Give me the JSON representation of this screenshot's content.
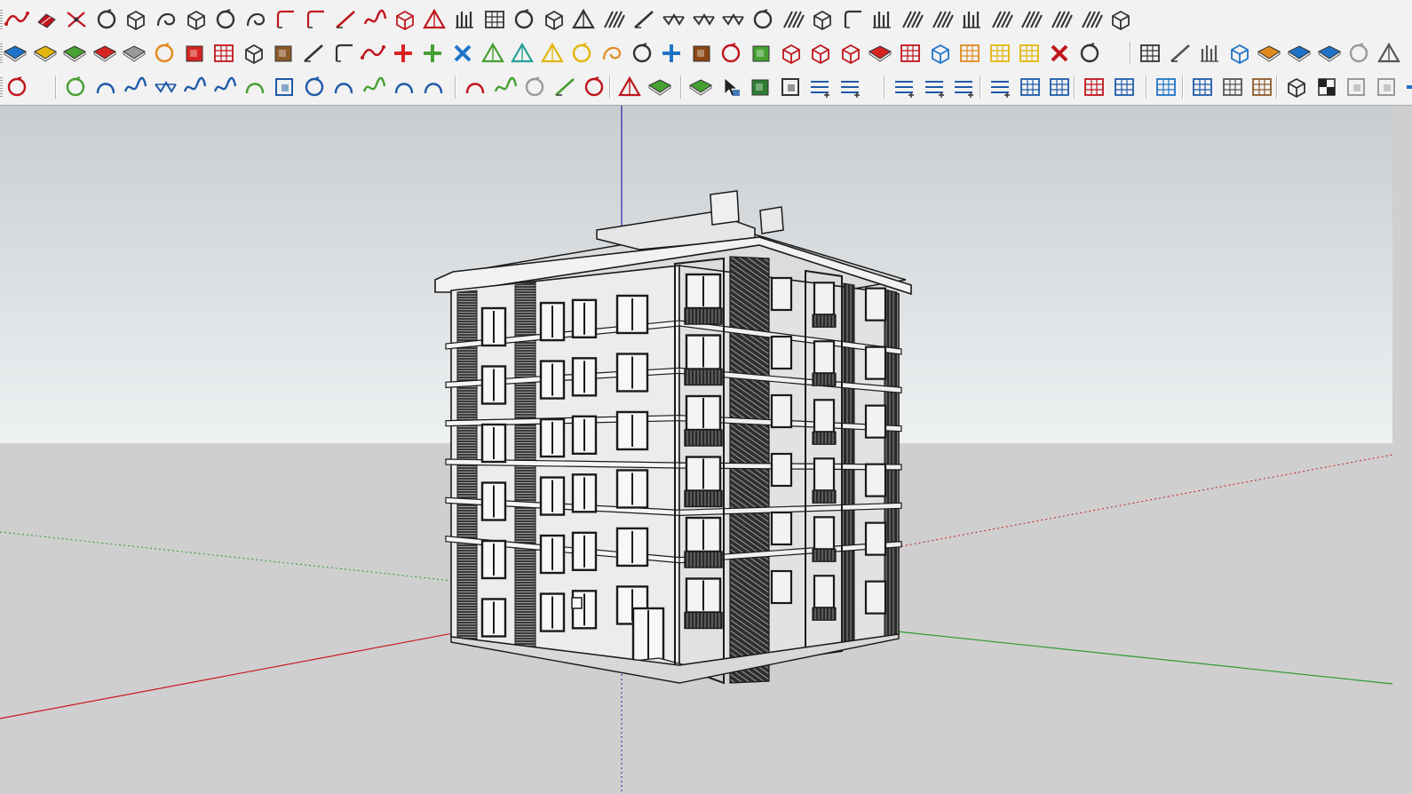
{
  "toolbars": {
    "rows": [
      [
        {
          "name": "bezier-curve-icon",
          "kind": "curve",
          "c": "#c0151d"
        },
        {
          "name": "erase-edges-icon",
          "kind": "eraser",
          "c": "#c0151d"
        },
        {
          "name": "weld-lines-icon",
          "kind": "cross",
          "c": "#c0151d"
        },
        {
          "name": "loft-icon",
          "kind": "loop",
          "c": "#333333"
        },
        {
          "name": "curviloft-icon",
          "kind": "box",
          "c": "#333333"
        },
        {
          "name": "skin-icon",
          "kind": "swirl",
          "c": "#333333"
        },
        {
          "name": "shell-icon",
          "kind": "box",
          "c": "#333333"
        },
        {
          "name": "roundcorner-icon",
          "kind": "loop",
          "c": "#333333"
        },
        {
          "name": "extrude-along-path-icon",
          "kind": "swirl",
          "c": "#333333"
        },
        {
          "name": "fillet-icon",
          "kind": "corner",
          "c": "#c0151d"
        },
        {
          "name": "chamfer-icon",
          "kind": "corner",
          "c": "#c0151d"
        },
        {
          "name": "extend-icon",
          "kind": "slash",
          "c": "#c0151d"
        },
        {
          "name": "trim-icon",
          "kind": "wave",
          "c": "#c0151d"
        },
        {
          "name": "mesh-icon",
          "kind": "box",
          "c": "#c0151d"
        },
        {
          "name": "section-icon",
          "kind": "tri",
          "c": "#c0151d"
        },
        {
          "name": "columns-icon",
          "kind": "bars",
          "c": "#333333"
        },
        {
          "name": "stairs-icon",
          "kind": "grid",
          "c": "#333333"
        },
        {
          "name": "hand-icon",
          "kind": "loop",
          "c": "#333333"
        },
        {
          "name": "window-icon",
          "kind": "box",
          "c": "#333333"
        },
        {
          "name": "door-icon",
          "kind": "tri",
          "c": "#333333"
        },
        {
          "name": "slab-icon",
          "kind": "hatch",
          "c": "#333333"
        },
        {
          "name": "ramp-icon",
          "kind": "slash",
          "c": "#333333"
        },
        {
          "name": "truss-icon",
          "kind": "zig",
          "c": "#333333"
        },
        {
          "name": "beam-icon",
          "kind": "zig",
          "c": "#333333"
        },
        {
          "name": "rafter-icon",
          "kind": "zig",
          "c": "#333333"
        },
        {
          "name": "dome-icon",
          "kind": "loop",
          "c": "#333333"
        },
        {
          "name": "roof-icon",
          "kind": "hatch",
          "c": "#333333"
        },
        {
          "name": "wall-icon",
          "kind": "box",
          "c": "#333333"
        },
        {
          "name": "stair-icon",
          "kind": "corner",
          "c": "#333333"
        },
        {
          "name": "fence-icon",
          "kind": "bars",
          "c": "#333333"
        },
        {
          "name": "railing-icon",
          "kind": "hatch",
          "c": "#333333"
        },
        {
          "name": "slat-icon",
          "kind": "hatch",
          "c": "#333333"
        },
        {
          "name": "grille-icon",
          "kind": "bars",
          "c": "#333333"
        },
        {
          "name": "roof-truss-icon",
          "kind": "hatch",
          "c": "#333333"
        },
        {
          "name": "shingles-icon",
          "kind": "hatch",
          "c": "#333333"
        },
        {
          "name": "cladding-icon",
          "kind": "hatch",
          "c": "#333333"
        },
        {
          "name": "frame-icon",
          "kind": "hatch",
          "c": "#333333"
        },
        {
          "name": "house-icon",
          "kind": "box",
          "c": "#333333"
        }
      ],
      [
        {
          "name": "plane-blue-icon",
          "kind": "diamond",
          "c": "#1e73c8"
        },
        {
          "name": "plane-yellow-icon",
          "kind": "diamond",
          "c": "#e3b50e"
        },
        {
          "name": "plane-green-icon",
          "kind": "diamond",
          "c": "#46a032"
        },
        {
          "name": "plane-red-icon",
          "kind": "diamond",
          "c": "#d62323"
        },
        {
          "name": "plane-outline-icon",
          "kind": "diamond",
          "c": "#9a9a9a"
        },
        {
          "name": "rotate-orange-icon",
          "kind": "loop",
          "c": "#e08a1e"
        },
        {
          "name": "push-red-icon",
          "kind": "square",
          "c": "#d62323"
        },
        {
          "name": "grid-red-icon",
          "kind": "grid",
          "c": "#c0151d"
        },
        {
          "name": "flag-icon",
          "kind": "box",
          "c": "#333333"
        },
        {
          "name": "crate-icon",
          "kind": "square",
          "c": "#8b5a2b"
        },
        {
          "name": "link-icon",
          "kind": "slash",
          "c": "#333333"
        },
        {
          "name": "offset-icon",
          "kind": "corner",
          "c": "#333333"
        },
        {
          "name": "polyline-icon",
          "kind": "curve",
          "c": "#c0151d"
        },
        {
          "name": "cross-red-icon",
          "kind": "plus",
          "c": "#d62323"
        },
        {
          "name": "cross-green-icon",
          "kind": "plus",
          "c": "#46a032"
        },
        {
          "name": "cross-blue-icon",
          "kind": "xcross",
          "c": "#1e73c8"
        },
        {
          "name": "cone-green-icon",
          "kind": "tri",
          "c": "#46a032"
        },
        {
          "name": "cone-teal-icon",
          "kind": "tri",
          "c": "#2aa198"
        },
        {
          "name": "cone-yellow-icon",
          "kind": "tri",
          "c": "#e3b50e"
        },
        {
          "name": "helix-icon",
          "kind": "loop",
          "c": "#e3b50e"
        },
        {
          "name": "spiral-icon",
          "kind": "swirl",
          "c": "#e08a1e"
        },
        {
          "name": "rotate-icon",
          "kind": "loop",
          "c": "#333333"
        },
        {
          "name": "move-icon",
          "kind": "plus",
          "c": "#1e73c8"
        },
        {
          "name": "cylinder-icon",
          "kind": "square",
          "c": "#8b4513"
        },
        {
          "name": "undo-icon",
          "kind": "loop",
          "c": "#c0151d"
        },
        {
          "name": "puzzle-icon",
          "kind": "square",
          "c": "#46a032"
        },
        {
          "name": "component-a-icon",
          "kind": "box",
          "c": "#c0151d"
        },
        {
          "name": "component-b-icon",
          "kind": "box",
          "c": "#c0151d"
        },
        {
          "name": "component-c-icon",
          "kind": "box",
          "c": "#c0151d"
        },
        {
          "name": "gem-icon",
          "kind": "diamond",
          "c": "#d62323"
        },
        {
          "name": "array-icon",
          "kind": "grid",
          "c": "#c0151d"
        },
        {
          "name": "panel-icon",
          "kind": "box",
          "c": "#1e73c8"
        },
        {
          "name": "tile-a-icon",
          "kind": "grid",
          "c": "#e08a1e"
        },
        {
          "name": "tile-b-icon",
          "kind": "grid",
          "c": "#e3b50e"
        },
        {
          "name": "tile-c-icon",
          "kind": "grid",
          "c": "#e3b50e"
        },
        {
          "name": "scatter-icon",
          "kind": "xcross",
          "c": "#c0151d"
        },
        {
          "name": "circle-points-icon",
          "kind": "loop",
          "c": "#333333"
        },
        {
          "name": "dimension-grid-icon",
          "kind": "grid",
          "c": "#333333"
        },
        {
          "name": "pencil-icon",
          "kind": "slash",
          "c": "#555555"
        },
        {
          "name": "align-icon",
          "kind": "bars",
          "c": "#555555"
        },
        {
          "name": "sandbox-icon",
          "kind": "box",
          "c": "#1e73c8"
        },
        {
          "name": "bucket-orange-icon",
          "kind": "diamond",
          "c": "#e08a1e"
        },
        {
          "name": "bucket-blue-icon",
          "kind": "diamond",
          "c": "#1e73c8"
        },
        {
          "name": "push-blue-icon",
          "kind": "diamond",
          "c": "#1e73c8"
        },
        {
          "name": "redo-icon",
          "kind": "loop",
          "c": "#9a9a9a"
        },
        {
          "name": "balance-icon",
          "kind": "tri",
          "c": "#555555"
        }
      ],
      [
        {
          "name": "lasso-icon",
          "kind": "loop",
          "c": "#c0151d"
        },
        {
          "name": "sphere-wire-icon",
          "kind": "loop",
          "c": "#46a032"
        },
        {
          "name": "arc-3pt-icon",
          "kind": "arc",
          "c": "#1e5aa8"
        },
        {
          "name": "spline-icon",
          "kind": "wave",
          "c": "#1e5aa8"
        },
        {
          "name": "freehand-icon",
          "kind": "zig",
          "c": "#1e5aa8"
        },
        {
          "name": "nurbs-icon",
          "kind": "wave",
          "c": "#1e5aa8"
        },
        {
          "name": "curve-a-icon",
          "kind": "wave",
          "c": "#1e5aa8"
        },
        {
          "name": "arc-green-icon",
          "kind": "arc",
          "c": "#46a032"
        },
        {
          "name": "rectangle-icon",
          "kind": "square-o",
          "c": "#1e5aa8"
        },
        {
          "name": "spiral-blue-icon",
          "kind": "loop",
          "c": "#1e5aa8"
        },
        {
          "name": "arc-b-icon",
          "kind": "arc",
          "c": "#1e5aa8"
        },
        {
          "name": "arc-c-icon",
          "kind": "wave",
          "c": "#46a032"
        },
        {
          "name": "hook-icon",
          "kind": "arc",
          "c": "#1e5aa8"
        },
        {
          "name": "arc-d-icon",
          "kind": "arc",
          "c": "#1e5aa8"
        },
        {
          "name": "arc-red-icon",
          "kind": "arc",
          "c": "#c0151d"
        },
        {
          "name": "curve-green-icon",
          "kind": "wave",
          "c": "#46a032"
        },
        {
          "name": "polygon-icon",
          "kind": "loop",
          "c": "#9a9a9a"
        },
        {
          "name": "wrench-icon",
          "kind": "slash",
          "c": "#46a032"
        },
        {
          "name": "ellipse-icon",
          "kind": "loop",
          "c": "#c0151d"
        },
        {
          "name": "sector-icon",
          "kind": "tri",
          "c": "#c0151d"
        },
        {
          "name": "book-icon",
          "kind": "diamond",
          "c": "#46a032"
        },
        {
          "name": "terrain-icon",
          "kind": "diamond",
          "c": "#46a032"
        },
        {
          "name": "select-icon",
          "kind": "cursor",
          "c": "#1e5aa8"
        },
        {
          "name": "scale-green-icon",
          "kind": "square",
          "c": "#2f7d32"
        },
        {
          "name": "scale-dark-icon",
          "kind": "square-o",
          "c": "#333333"
        },
        {
          "name": "align-left-icon",
          "kind": "lines",
          "c": "#1e5aa8"
        },
        {
          "name": "align-plus-icon",
          "kind": "lines",
          "c": "#1e5aa8"
        },
        {
          "name": "align-minus-icon",
          "kind": "lines",
          "c": "#1e5aa8"
        },
        {
          "name": "divide-a-icon",
          "kind": "lines",
          "c": "#1e5aa8"
        },
        {
          "name": "divide-plus-icon",
          "kind": "lines",
          "c": "#1e5aa8"
        },
        {
          "name": "divide-minus-icon",
          "kind": "lines",
          "c": "#1e5aa8"
        },
        {
          "name": "face-x-icon",
          "kind": "grid",
          "c": "#1e5aa8"
        },
        {
          "name": "face-grid-icon",
          "kind": "grid",
          "c": "#1e5aa8"
        },
        {
          "name": "face-red-icon",
          "kind": "grid",
          "c": "#c0151d"
        },
        {
          "name": "table-icon",
          "kind": "grid",
          "c": "#1e5aa8"
        },
        {
          "name": "table-blue-icon",
          "kind": "grid",
          "c": "#1e73c8"
        },
        {
          "name": "split-icon",
          "kind": "grid",
          "c": "#1e5aa8"
        },
        {
          "name": "curtain-wall-icon",
          "kind": "grid",
          "c": "#555555"
        },
        {
          "name": "roof-tiles-icon",
          "kind": "grid",
          "c": "#8b5a2b"
        },
        {
          "name": "dome-dark-icon",
          "kind": "box",
          "c": "#333333"
        },
        {
          "name": "checker-icon",
          "kind": "checker",
          "c": "#222222"
        },
        {
          "name": "copy-icon",
          "kind": "square-o",
          "c": "#9a9a9a"
        },
        {
          "name": "paste-icon",
          "kind": "square-o",
          "c": "#9a9a9a"
        },
        {
          "name": "move-blue-icon",
          "kind": "plus",
          "c": "#1e73c8"
        }
      ]
    ],
    "separators": [
      [],
      [
        1272
      ],
      [
        62,
        512,
        686,
        766,
        995,
        1103,
        1209,
        1290,
        1331,
        1437
      ]
    ]
  },
  "viewport": {
    "colors": {
      "sky_top": "#c9cdd0",
      "sky_bottom": "#eef1f2",
      "ground": "#cfcfcf",
      "axis_red": "#c8191e",
      "axis_green": "#2e9a2e",
      "axis_blue": "#2323b4",
      "wall_light": "#ececec",
      "wall_side": "#e2e2e2",
      "edge": "#1a1a1a"
    },
    "building": {
      "floors": 6,
      "front_window_bays": 4,
      "side_window_bays": 3
    }
  }
}
